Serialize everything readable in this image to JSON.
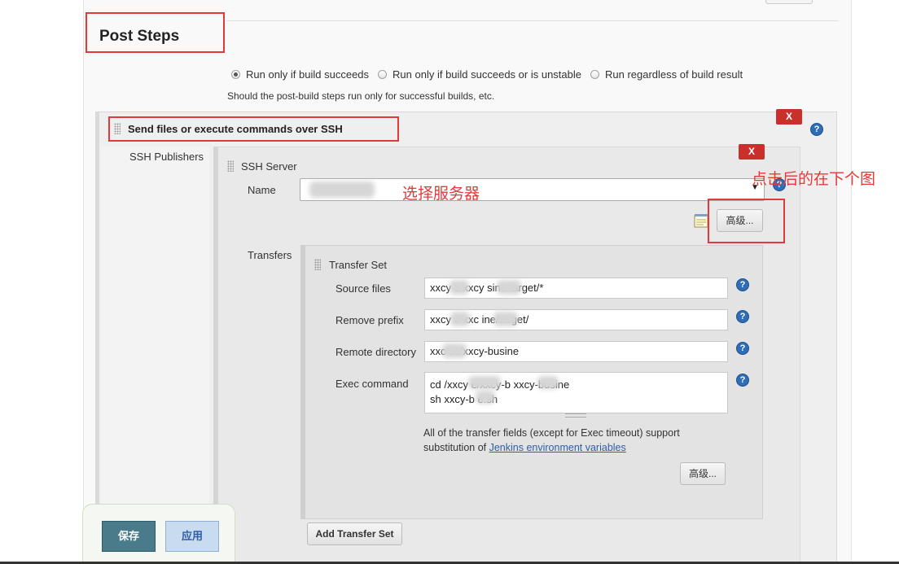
{
  "post_steps": {
    "title": "Post Steps",
    "radio_options": [
      {
        "label": "Run only if build succeeds",
        "checked": true
      },
      {
        "label": "Run only if build succeeds or is unstable",
        "checked": false
      },
      {
        "label": "Run regardless of build result",
        "checked": false
      }
    ],
    "help_text": "Should the post-build steps run only for successful builds, etc."
  },
  "ssh_step": {
    "title": "Send files or execute commands over SSH",
    "delete_label": "X",
    "publishers_label": "SSH Publishers",
    "server": {
      "title": "SSH Server",
      "delete_label": "X",
      "name_label": "Name",
      "name_value": "",
      "annotation": "选择服务器",
      "advanced_label": "高级...",
      "advanced_annotation": "点击后的在下个图"
    },
    "transfers_label": "Transfers",
    "transfer_set": {
      "title": "Transfer Set",
      "fields": {
        "source_files": {
          "label": "Source files",
          "value": "xxcy      e/xxcy      sine/target/*"
        },
        "remove_prefix": {
          "label": "Remove prefix",
          "value": "xxcy     e/xxc      ine/target/"
        },
        "remote_directory": {
          "label": "Remote directory",
          "value": "xxc      se/xxcy-busine"
        },
        "exec_command": {
          "label": "Exec command",
          "lines": [
            "cd /xxcy       e/xxcy-b       xxcy-busine",
            "sh xxcy-b      e.sh"
          ]
        }
      },
      "note_text": "All of the transfer fields (except for Exec timeout) support substitution of ",
      "note_link": "Jenkins environment variables",
      "advanced_label": "高级..."
    },
    "add_transfer_set_label": "Add Transfer Set"
  },
  "footer": {
    "save_label": "保存",
    "apply_label": "应用"
  },
  "colors": {
    "annotation_red": "#e23a3a",
    "delete_red": "#c9302c",
    "help_blue": "#2f6db5",
    "save_teal": "#4a7b8a"
  }
}
